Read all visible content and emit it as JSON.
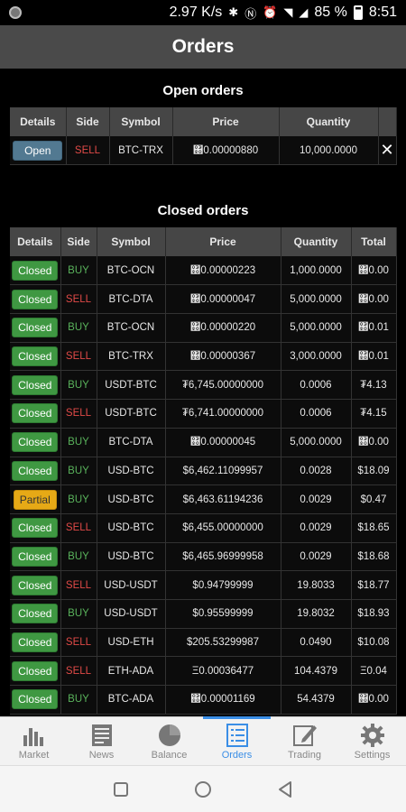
{
  "status": {
    "speed": "2.97 K/s",
    "battery": "85 %",
    "time": "8:51"
  },
  "appbar": {
    "title": "Orders"
  },
  "open_orders": {
    "title": "Open orders",
    "headers": [
      "Details",
      "Side",
      "Symbol",
      "Price",
      "Quantity",
      ""
    ],
    "rows": [
      {
        "details": "Open",
        "side": "SELL",
        "symbol": "BTC-TRX",
        "price": "΀0.00000880",
        "quantity": "10,000.0000",
        "action": "✕"
      }
    ]
  },
  "closed_orders": {
    "title": "Closed orders",
    "headers": [
      "Details",
      "Side",
      "Symbol",
      "Price",
      "Quantity",
      "Total"
    ],
    "rows": [
      {
        "details": "Closed",
        "side": "BUY",
        "symbol": "BTC-OCN",
        "price": "΀0.00000223",
        "quantity": "1,000.0000",
        "total": "΀0.00"
      },
      {
        "details": "Closed",
        "side": "SELL",
        "symbol": "BTC-DTA",
        "price": "΀0.00000047",
        "quantity": "5,000.0000",
        "total": "΀0.00"
      },
      {
        "details": "Closed",
        "side": "BUY",
        "symbol": "BTC-OCN",
        "price": "΀0.00000220",
        "quantity": "5,000.0000",
        "total": "΀0.01"
      },
      {
        "details": "Closed",
        "side": "SELL",
        "symbol": "BTC-TRX",
        "price": "΀0.00000367",
        "quantity": "3,000.0000",
        "total": "΀0.01"
      },
      {
        "details": "Closed",
        "side": "BUY",
        "symbol": "USDT-BTC",
        "price": "₮6,745.00000000",
        "quantity": "0.0006",
        "total": "₮4.13"
      },
      {
        "details": "Closed",
        "side": "SELL",
        "symbol": "USDT-BTC",
        "price": "₮6,741.00000000",
        "quantity": "0.0006",
        "total": "₮4.15"
      },
      {
        "details": "Closed",
        "side": "BUY",
        "symbol": "BTC-DTA",
        "price": "΀0.00000045",
        "quantity": "5,000.0000",
        "total": "΀0.00"
      },
      {
        "details": "Closed",
        "side": "BUY",
        "symbol": "USD-BTC",
        "price": "$6,462.11099957",
        "quantity": "0.0028",
        "total": "$18.09"
      },
      {
        "details": "Partial",
        "side": "BUY",
        "symbol": "USD-BTC",
        "price": "$6,463.61194236",
        "quantity": "0.0029",
        "total": "$0.47"
      },
      {
        "details": "Closed",
        "side": "SELL",
        "symbol": "USD-BTC",
        "price": "$6,455.00000000",
        "quantity": "0.0029",
        "total": "$18.65"
      },
      {
        "details": "Closed",
        "side": "BUY",
        "symbol": "USD-BTC",
        "price": "$6,465.96999958",
        "quantity": "0.0029",
        "total": "$18.68"
      },
      {
        "details": "Closed",
        "side": "SELL",
        "symbol": "USD-USDT",
        "price": "$0.94799999",
        "quantity": "19.8033",
        "total": "$18.77"
      },
      {
        "details": "Closed",
        "side": "BUY",
        "symbol": "USD-USDT",
        "price": "$0.95599999",
        "quantity": "19.8032",
        "total": "$18.93"
      },
      {
        "details": "Closed",
        "side": "SELL",
        "symbol": "USD-ETH",
        "price": "$205.53299987",
        "quantity": "0.0490",
        "total": "$10.08"
      },
      {
        "details": "Closed",
        "side": "SELL",
        "symbol": "ETH-ADA",
        "price": "Ξ0.00036477",
        "quantity": "104.4379",
        "total": "Ξ0.04"
      },
      {
        "details": "Closed",
        "side": "BUY",
        "symbol": "BTC-ADA",
        "price": "΀0.00001169",
        "quantity": "54.4379",
        "total": "΀0.00"
      }
    ]
  },
  "tabs": [
    {
      "label": "Market",
      "icon": "bar-chart-icon",
      "active": false
    },
    {
      "label": "News",
      "icon": "news-icon",
      "active": false
    },
    {
      "label": "Balance",
      "icon": "pie-chart-icon",
      "active": false
    },
    {
      "label": "Orders",
      "icon": "list-icon",
      "active": true
    },
    {
      "label": "Trading",
      "icon": "edit-icon",
      "active": false
    },
    {
      "label": "Settings",
      "icon": "gear-icon",
      "active": false
    }
  ],
  "colors": {
    "buy": "#59b25b",
    "sell": "#e04a47",
    "closed": "#3f9842",
    "partial": "#e6a916",
    "open": "#527991",
    "accent": "#3a8ee6"
  }
}
